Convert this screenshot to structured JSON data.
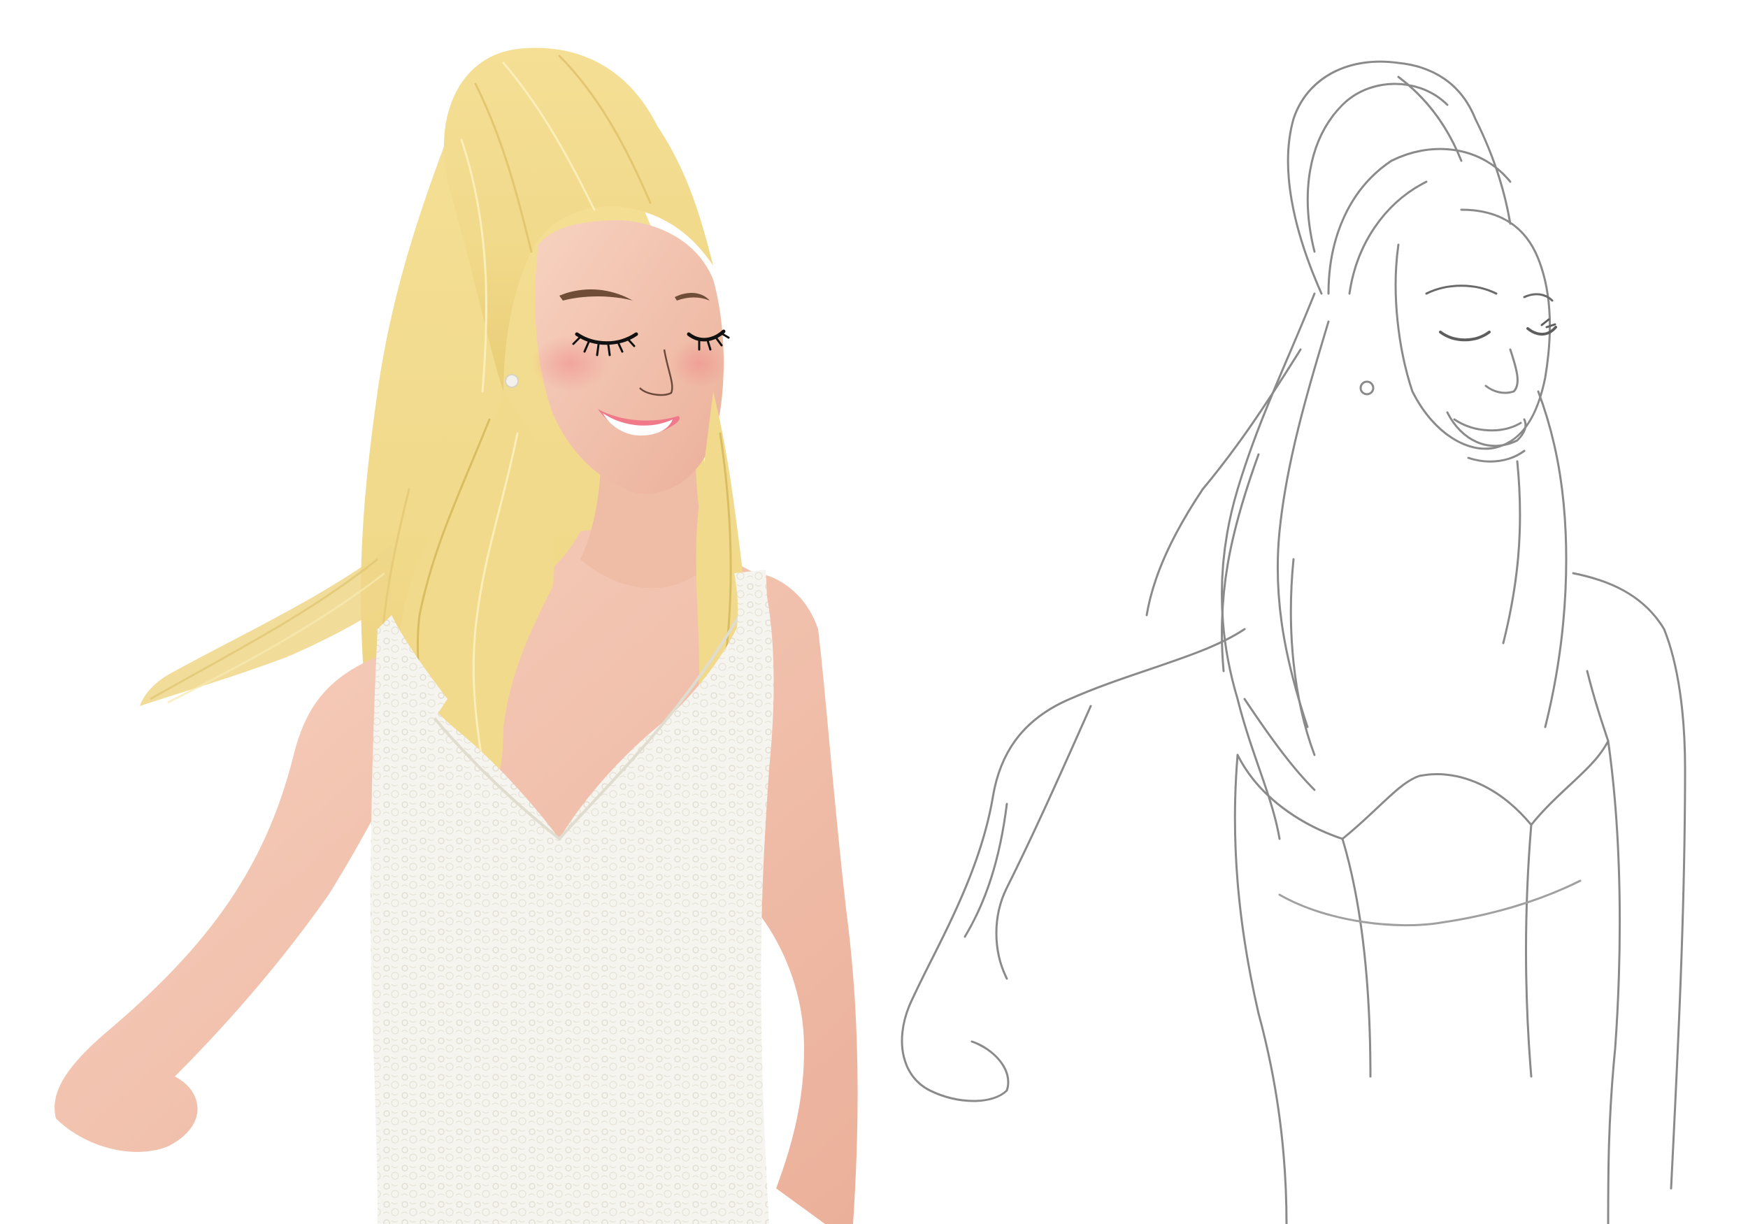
{
  "canvas": {
    "background": "#ffffff"
  },
  "panels": [
    {
      "id": "colored-illustration",
      "style": "digital painting",
      "subject": "bride-with-closed-eyes-smiling",
      "colors": {
        "skin": "#f2c3ae",
        "skin_shadow": "#e8a990",
        "blush": "#f08a8a",
        "hair": "#f3dc8e",
        "hair_highlight": "#fbeeb8",
        "hair_shadow": "#d8bc62",
        "dress": "#f6f4ee",
        "dress_lace": "#e4e0d4",
        "lips": "#f07a8a",
        "eyelash": "#111111",
        "brow": "#6f4d36",
        "earring": "#f3f1ec"
      }
    },
    {
      "id": "pencil-sketch",
      "style": "graphite line drawing",
      "subject": "bride-with-closed-eyes-smiling",
      "colors": {
        "line": "#8a8a8a",
        "line_dark": "#5e5e5e"
      }
    }
  ]
}
